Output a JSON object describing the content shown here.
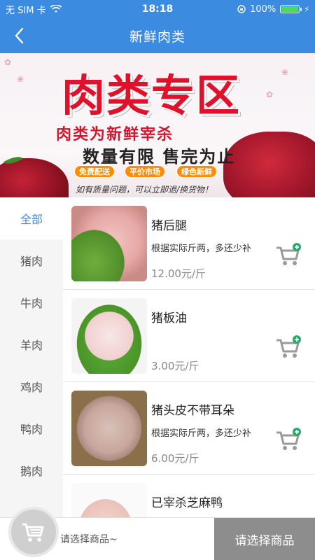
{
  "status_bar": {
    "carrier": "无 SIM 卡",
    "time": "18:18",
    "battery": "100%"
  },
  "nav": {
    "title": "新鲜肉类"
  },
  "banner": {
    "title": "肉类专区",
    "line1": "肉类为新鲜宰杀",
    "line2": "数量有限 售完为止",
    "tags": [
      "免费配送",
      "平价市场",
      "绿色新鲜"
    ],
    "note": "如有质量问题，可以立即退/换货物！"
  },
  "categories": [
    {
      "label": "全部"
    },
    {
      "label": "猪肉"
    },
    {
      "label": "牛肉"
    },
    {
      "label": "羊肉"
    },
    {
      "label": "鸡肉"
    },
    {
      "label": "鸭肉"
    },
    {
      "label": "鹅肉"
    }
  ],
  "products": [
    {
      "name": "猪后腿",
      "desc": "根据实际斤两，多还少补",
      "price": "12.00元/斤"
    },
    {
      "name": "猪板油",
      "desc": "",
      "price": "3.00元/斤"
    },
    {
      "name": "猪头皮不带耳朵",
      "desc": "根据实际斤两，多还少补",
      "price": "6.00元/斤"
    },
    {
      "name": "已宰杀芝麻鸭",
      "desc": "",
      "price": ""
    }
  ],
  "bottom": {
    "hint": "请选择商品~",
    "submit": "请选择商品"
  },
  "colors": {
    "primary": "#3b8be0",
    "banner_red": "#e0122b",
    "submit_bg": "#8d8d8d"
  },
  "icons": [
    "back-arrow-icon",
    "wifi-icon",
    "battery-icon",
    "add-to-cart-icon",
    "shopping-cart-icon"
  ]
}
